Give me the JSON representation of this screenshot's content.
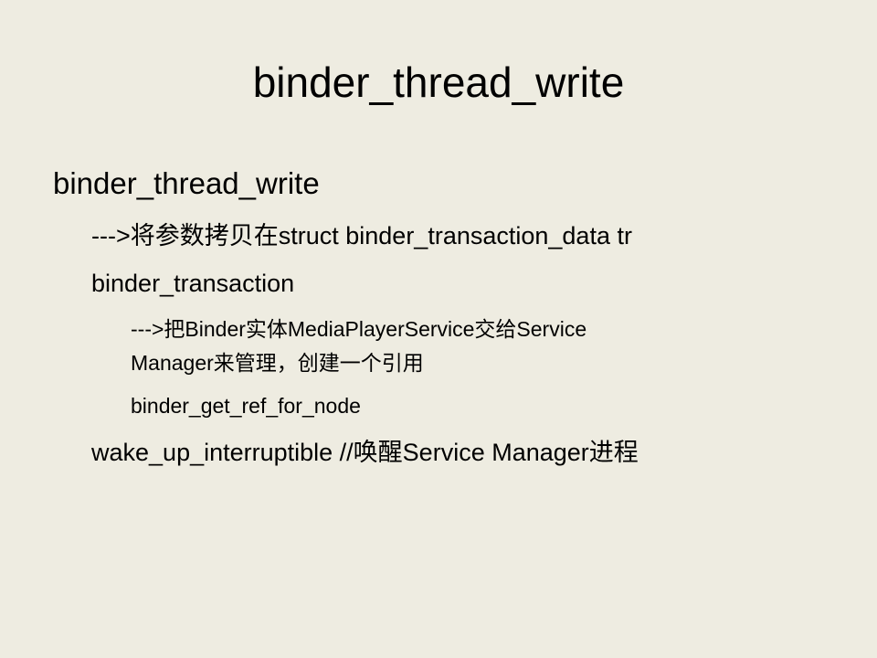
{
  "slide": {
    "title": "binder_thread_write",
    "body": {
      "level1": "binder_thread_write",
      "line1": "--->将参数拷贝在struct binder_transaction_data tr",
      "line2": "binder_transaction",
      "line3a": "--->把Binder实体MediaPlayerService交给Service",
      "line3b": "Manager来管理，创建一个引用",
      "line4": "binder_get_ref_for_node",
      "line5": "wake_up_interruptible  //唤醒Service Manager进程"
    }
  }
}
